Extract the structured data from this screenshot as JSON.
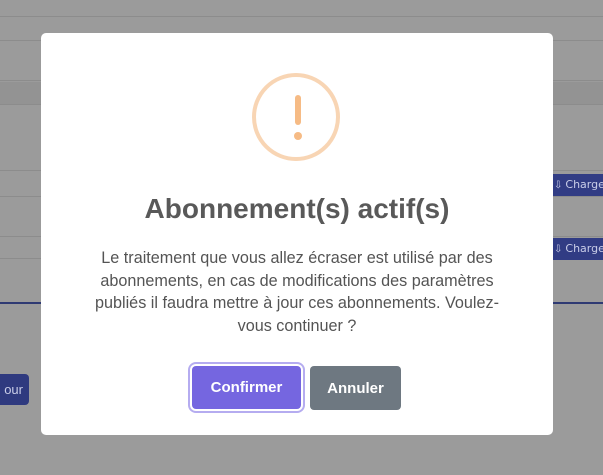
{
  "background": {
    "download_button_label": "Charger",
    "left_button_label": "our"
  },
  "modal": {
    "icon": "exclamation-warning-icon",
    "title": "Abonnement(s) actif(s)",
    "message_lines": [
      "Le traitement que vous allez écraser est utilisé par des",
      "abonnements, en cas de modifications des paramètres",
      "publiés il faudra mettre à jour ces abonnements. Voulez-",
      "vous continuer ?"
    ],
    "confirm_label": "Confirmer",
    "cancel_label": "Annuler"
  },
  "colors": {
    "confirm": "#7566e0",
    "cancel": "#6e7881",
    "warning": "#f6bb85",
    "overlay": "#9b9b9b",
    "background_button": "#313c84"
  }
}
